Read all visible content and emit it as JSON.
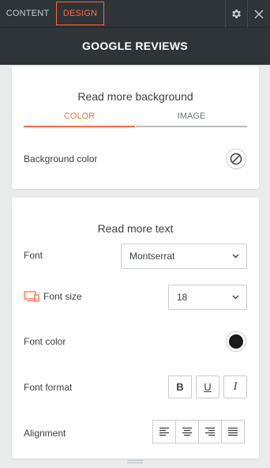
{
  "tabs": {
    "content": "CONTENT",
    "design": "DESIGN"
  },
  "panel_title": "GOOGLE REVIEWS",
  "read_more_background": {
    "title": "Read more background",
    "subtabs": {
      "color": "COLOR",
      "image": "IMAGE"
    },
    "background_color_label": "Background color"
  },
  "read_more_text": {
    "title": "Read more text",
    "font_label": "Font",
    "font_value": "Montserrat",
    "font_size_label": "Font size",
    "font_size_value": "18",
    "font_color_label": "Font color",
    "font_color": "#1a1a1a",
    "font_format_label": "Font format",
    "bold": "B",
    "underline": "U",
    "italic": "I",
    "alignment_label": "Alignment"
  },
  "colors": {
    "accent": "#ff6b3d",
    "header": "#2e3438"
  },
  "icons": [
    "settings-icon",
    "close-icon",
    "no-color-icon",
    "chevron-down-icon",
    "responsive-devices-icon",
    "align-left-icon",
    "align-center-icon",
    "align-right-icon",
    "align-justify-icon",
    "resize-handle-icon"
  ]
}
